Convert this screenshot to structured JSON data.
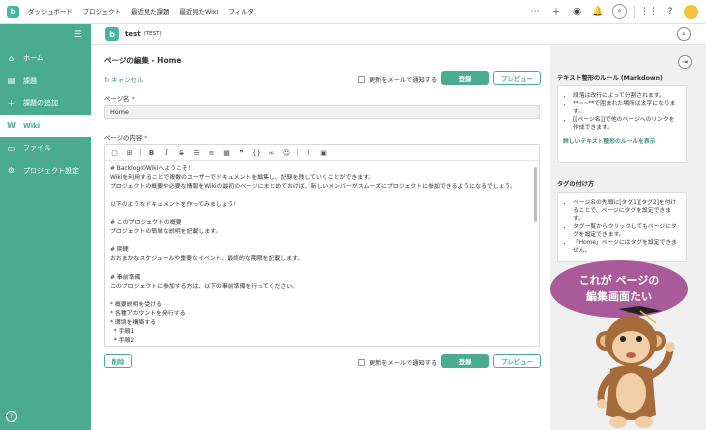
{
  "topnav": {
    "logo_letter": "b",
    "items": [
      "ダッシュボード",
      "プロジェクト",
      "最近見た課題",
      "最近見たWiki",
      "フィルタ"
    ]
  },
  "topbar_icons": [
    "more-icon",
    "plus-icon",
    "eye-icon",
    "bell-icon",
    "search-icon",
    "apps-icon",
    "help-icon",
    "avatar"
  ],
  "sidebar": {
    "items": [
      {
        "label": "ホーム",
        "icon": "home-icon"
      },
      {
        "label": "課題",
        "icon": "list-icon"
      },
      {
        "label": "課題の追加",
        "icon": "plus-icon"
      },
      {
        "label": "Wiki",
        "icon": "wiki-icon",
        "active": true
      },
      {
        "label": "ファイル",
        "icon": "folder-icon"
      },
      {
        "label": "プロジェクト設定",
        "icon": "gear-icon"
      }
    ]
  },
  "project": {
    "logo_letter": "b",
    "name": "test",
    "key": "(TEST)"
  },
  "main": {
    "title": "ページの編集 - Home",
    "cancel": "キャンセル",
    "notify_label": "更新をメールで通知する",
    "save": "登録",
    "preview": "プレビュー",
    "page_name_label": "ページ名",
    "page_name_value": "Home",
    "content_label": "ページの内容",
    "required_mark": "*",
    "delete": "削除",
    "editor_text": "# BacklogのWikiへようこそ！\nWikiを利用することで複数のユーザーでドキュメントを編集し、記録を残していくことができます。\nプロジェクトの概要や必要な情報をWikiの最初のページにまとめておけば、新しいメンバーがスムーズにプロジェクトに参加できるようになるでしょう。\n\n以下のようなドキュメントを作ってみましょう！\n\n# このプロジェクトの概要\nプロジェクトの簡単な説明を記載します。\n\n# 期間\nおおまかなスケジュールや重要なイベント、最終的な期限を記載します。\n\n# 事前準備\nこのプロジェクトに参加する方は、以下の事前準備を行ってください。\n\n* 概要説明を受ける\n* 各種アカウントを発行する\n* 環境を構築する\n  * 手順1\n  * 手順2"
  },
  "right_panel": {
    "rules_heading": "テキスト整形のルール (Markdown)",
    "rules": [
      "段落は改行によって分割されます。",
      "**~~**で囲まれた場所は太字になります。",
      "[[ページ名]]で他のページへのリンクを作成できます。"
    ],
    "rules_link": "詳しいテキスト整形のルールを表示",
    "tags_heading": "タグの付け方",
    "tags": [
      "ページ名の先頭に[タグ1][タグ2]を付けることで、ページにタグを設定できます。",
      "タグ一覧からクリックしてもページにタグを設定できます。",
      "「Home」ページにはタグを設定できません。"
    ]
  },
  "bubble": {
    "line1": "これが ページの",
    "line2": "編集画面たい"
  },
  "colors": {
    "accent": "#4aab8f",
    "bubble": "#a85a99"
  }
}
